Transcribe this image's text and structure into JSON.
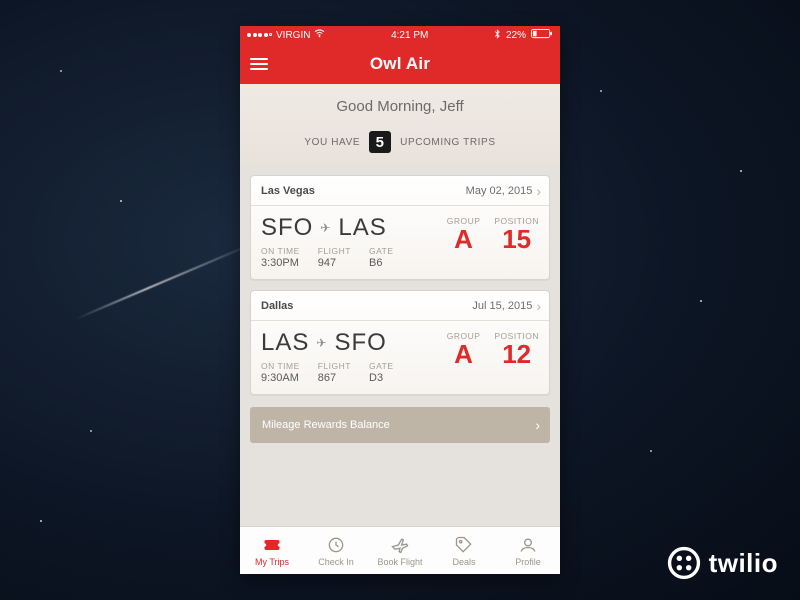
{
  "status": {
    "carrier": "VIRGIN",
    "time": "4:21 PM",
    "battery_pct": "22%"
  },
  "nav": {
    "title": "Owl Air"
  },
  "hero": {
    "greeting": "Good Morning, Jeff",
    "you_have": "YOU HAVE",
    "count": "5",
    "upcoming": "UPCOMING TRIPS"
  },
  "labels": {
    "on_time": "ON TIME",
    "flight": "FLIGHT",
    "gate": "GATE",
    "group": "GROUP",
    "position": "POSITION"
  },
  "trips": [
    {
      "destination": "Las Vegas",
      "date": "May 02, 2015",
      "from": "SFO",
      "to": "LAS",
      "time": "3:30PM",
      "flight": "947",
      "gate": "B6",
      "group": "A",
      "position": "15"
    },
    {
      "destination": "Dallas",
      "date": "Jul 15, 2015",
      "from": "LAS",
      "to": "SFO",
      "time": "9:30AM",
      "flight": "867",
      "gate": "D3",
      "group": "A",
      "position": "12"
    }
  ],
  "rewards": {
    "label": "Mileage Rewards Balance"
  },
  "tabs": {
    "my_trips": "My Trips",
    "check_in": "Check In",
    "book_flight": "Book Flight",
    "deals": "Deals",
    "profile": "Profile"
  },
  "brand": {
    "name": "twilio"
  }
}
